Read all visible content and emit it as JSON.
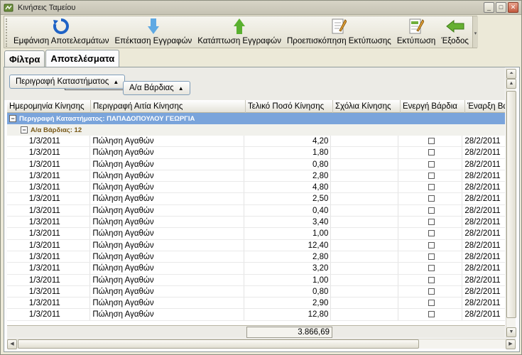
{
  "window": {
    "title": "Κινήσεις Ταμείου"
  },
  "toolbar": {
    "buttons": [
      {
        "label": "Εμφάνιση Αποτελεσμάτων",
        "icon": "refresh-icon"
      },
      {
        "label": "Επέκταση Εγγραφών",
        "icon": "arrow-down-icon"
      },
      {
        "label": "Κατάπτωση Εγγραφών",
        "icon": "arrow-up-icon"
      },
      {
        "label": "Προεπισκόπηση Εκτύπωσης",
        "icon": "print-preview-icon"
      },
      {
        "label": "Εκτύπωση",
        "icon": "print-icon"
      },
      {
        "label": "Έξοδος",
        "icon": "exit-arrow-icon"
      }
    ]
  },
  "tabs": [
    {
      "label": "Φίλτρα"
    },
    {
      "label": "Αποτελέσματα"
    }
  ],
  "groupby": {
    "chip1": "Περιγραφή Καταστήματος",
    "chip2": "Α/α Βάρδιας"
  },
  "columns": [
    "Ημερομηνία Κίνησης",
    "Περιγραφή Αιτία Κίνησης",
    "Τελικό Ποσό Κίνησης",
    "Σχόλια Κίνησης",
    "Ενεργή Βάρδια",
    "Έναρξη Βά"
  ],
  "groups": {
    "level1": "Περιγραφή Καταστήματος: ΠΑΠΑΔΟΠΟΥΛΟΥ ΓΕΩΡΓΙΑ",
    "level2": "Α/α Βάρδιας: 12"
  },
  "rows": [
    {
      "date": "1/3/2011",
      "desc": "Πώληση Αγαθών",
      "amount": "4,20",
      "comment": "",
      "start": "28/2/2011"
    },
    {
      "date": "1/3/2011",
      "desc": "Πώληση Αγαθών",
      "amount": "1,80",
      "comment": "",
      "start": "28/2/2011"
    },
    {
      "date": "1/3/2011",
      "desc": "Πώληση Αγαθών",
      "amount": "0,80",
      "comment": "",
      "start": "28/2/2011"
    },
    {
      "date": "1/3/2011",
      "desc": "Πώληση Αγαθών",
      "amount": "2,80",
      "comment": "",
      "start": "28/2/2011"
    },
    {
      "date": "1/3/2011",
      "desc": "Πώληση Αγαθών",
      "amount": "4,80",
      "comment": "",
      "start": "28/2/2011"
    },
    {
      "date": "1/3/2011",
      "desc": "Πώληση Αγαθών",
      "amount": "2,50",
      "comment": "",
      "start": "28/2/2011"
    },
    {
      "date": "1/3/2011",
      "desc": "Πώληση Αγαθών",
      "amount": "0,40",
      "comment": "",
      "start": "28/2/2011"
    },
    {
      "date": "1/3/2011",
      "desc": "Πώληση Αγαθών",
      "amount": "3,40",
      "comment": "",
      "start": "28/2/2011"
    },
    {
      "date": "1/3/2011",
      "desc": "Πώληση Αγαθών",
      "amount": "1,00",
      "comment": "",
      "start": "28/2/2011"
    },
    {
      "date": "1/3/2011",
      "desc": "Πώληση Αγαθών",
      "amount": "12,40",
      "comment": "",
      "start": "28/2/2011"
    },
    {
      "date": "1/3/2011",
      "desc": "Πώληση Αγαθών",
      "amount": "2,80",
      "comment": "",
      "start": "28/2/2011"
    },
    {
      "date": "1/3/2011",
      "desc": "Πώληση Αγαθών",
      "amount": "3,20",
      "comment": "",
      "start": "28/2/2011"
    },
    {
      "date": "1/3/2011",
      "desc": "Πώληση Αγαθών",
      "amount": "1,00",
      "comment": "",
      "start": "28/2/2011"
    },
    {
      "date": "1/3/2011",
      "desc": "Πώληση Αγαθών",
      "amount": "0,80",
      "comment": "",
      "start": "28/2/2011"
    },
    {
      "date": "1/3/2011",
      "desc": "Πώληση Αγαθών",
      "amount": "2,90",
      "comment": "",
      "start": "28/2/2011"
    },
    {
      "date": "1/3/2011",
      "desc": "Πώληση Αγαθών",
      "amount": "12,80",
      "comment": "",
      "start": "28/2/2011"
    }
  ],
  "summary": {
    "total": "3.866,69"
  },
  "colors": {
    "group_header": "#7aa4db",
    "subgroup_text": "#7a5a19"
  }
}
